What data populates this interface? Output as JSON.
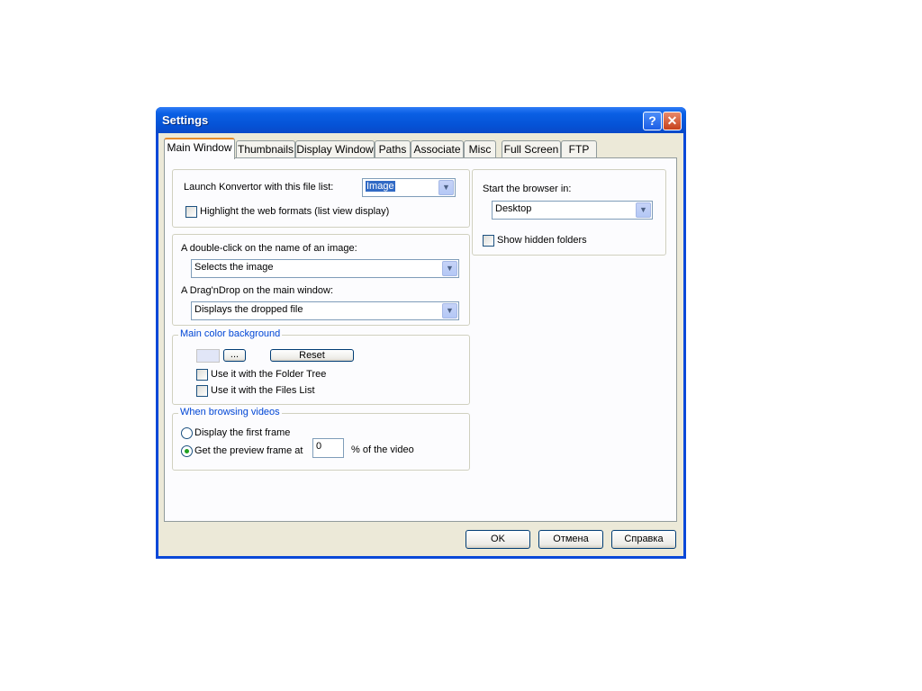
{
  "window": {
    "title": "Settings",
    "help_glyph": "?",
    "close_glyph": "✕"
  },
  "tabs": [
    {
      "label": "Main Window",
      "active": true
    },
    {
      "label": "Thumbnails"
    },
    {
      "label": "Display Window"
    },
    {
      "label": "Paths"
    },
    {
      "label": "Associate"
    },
    {
      "label": "Misc"
    },
    {
      "label": "Full Screen"
    },
    {
      "label": "FTP"
    }
  ],
  "launch": {
    "label": "Launch Konvertor with this file list:",
    "value": "Image",
    "highlight_label": "Highlight the web formats (list view display)",
    "highlight_checked": false
  },
  "actions": {
    "double_click_label": "A double-click on the name of an image:",
    "double_click_value": "Selects the image",
    "drag_label": "A Drag'nDrop on the main window:",
    "drag_value": "Displays the dropped file"
  },
  "color": {
    "legend": "Main color background",
    "swatch": "#e1e6f7",
    "browse_label": "...",
    "reset_label": "Reset",
    "folder_tree_label": "Use it with the Folder Tree",
    "folder_tree_checked": false,
    "files_list_label": "Use it with the Files List",
    "files_list_checked": false
  },
  "videos": {
    "legend": "When browsing videos",
    "first_frame_label": "Display the first frame",
    "preview_label": "Get the preview frame at",
    "preview_selected": true,
    "percent_value": "0",
    "percent_suffix": "% of the video"
  },
  "browser": {
    "label": "Start the browser in:",
    "value": "Desktop",
    "hidden_label": "Show hidden folders",
    "hidden_checked": false
  },
  "buttons": {
    "ok": "OK",
    "cancel": "Отмена",
    "help": "Справка"
  },
  "icons": {
    "dropdown": "▼"
  }
}
